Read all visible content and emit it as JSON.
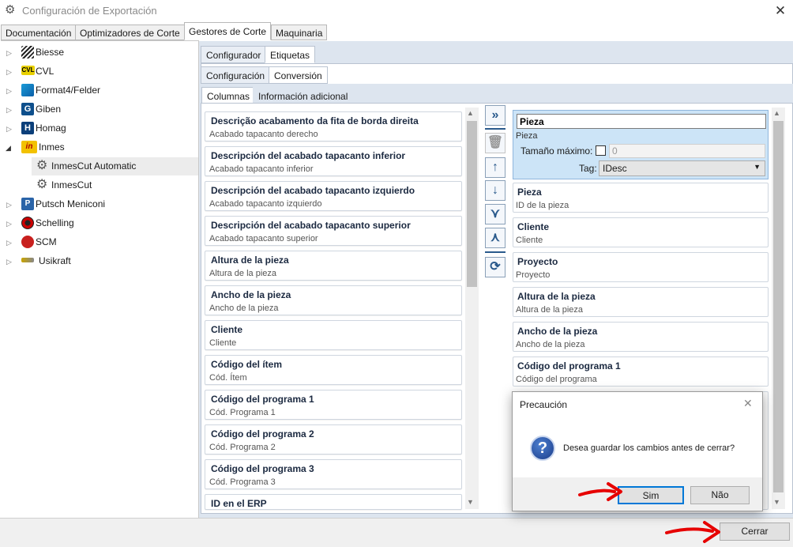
{
  "window": {
    "title": "Configuración de Exportación",
    "icon": "gear-icon",
    "close": "✕"
  },
  "main_tabs": [
    "Documentación",
    "Optimizadores de Corte",
    "Gestores de Corte",
    "Maquinaria"
  ],
  "tree": [
    {
      "label": "Biesse",
      "icon": "biesse-logo-icon"
    },
    {
      "label": "CVL",
      "icon": "cvl-logo-icon",
      "badge": "CVL"
    },
    {
      "label": "Format4/Felder",
      "icon": "format4-logo-icon"
    },
    {
      "label": "Giben",
      "icon": "giben-logo-icon",
      "badge": "G"
    },
    {
      "label": "Homag",
      "icon": "homag-logo-icon",
      "badge": "H"
    },
    {
      "label": "Inmes",
      "icon": "inmes-logo-icon",
      "badge": "in"
    },
    {
      "label": "InmesCut Automatic",
      "icon": "gear-icon"
    },
    {
      "label": "InmesCut",
      "icon": "gear-icon"
    },
    {
      "label": "Putsch Meniconi",
      "icon": "putsch-logo-icon",
      "badge": "P"
    },
    {
      "label": "Schelling",
      "icon": "schelling-logo-icon"
    },
    {
      "label": "SCM",
      "icon": "scm-logo-icon"
    },
    {
      "label": "Usikraft",
      "icon": "usikraft-logo-icon"
    }
  ],
  "sub_tabs_1": [
    "Configurador",
    "Etiquetas"
  ],
  "sub_tabs_2": [
    "Configuración",
    "Conversión"
  ],
  "sub_tabs_3": [
    "Columnas",
    "Información adicional"
  ],
  "available_columns": [
    {
      "title": "Descrição acabamento da fita de borda direita",
      "subtitle": "Acabado tapacanto derecho"
    },
    {
      "title": "Descripción del acabado tapacanto inferior",
      "subtitle": "Acabado tapacanto inferior"
    },
    {
      "title": "Descripción del acabado tapacanto izquierdo",
      "subtitle": "Acabado tapacanto izquierdo"
    },
    {
      "title": "Descripción del acabado tapacanto superior",
      "subtitle": "Acabado tapacanto superior"
    },
    {
      "title": "Altura de la pieza",
      "subtitle": "Altura de la pieza"
    },
    {
      "title": "Ancho de la pieza",
      "subtitle": "Ancho de la pieza"
    },
    {
      "title": "Cliente",
      "subtitle": "Cliente"
    },
    {
      "title": "Código del ítem",
      "subtitle": "Cód. Ítem"
    },
    {
      "title": "Código del programa 1",
      "subtitle": "Cód. Programa 1"
    },
    {
      "title": "Código del programa 2",
      "subtitle": "Cód. Programa 2"
    },
    {
      "title": "Código del programa 3",
      "subtitle": "Cód. Programa 3"
    },
    {
      "title": "ID en el ERP",
      "subtitle": ""
    }
  ],
  "toolbar_icons": [
    "move-all-right-icon",
    "delete-icon",
    "move-up-icon",
    "move-down-icon",
    "merge-icon",
    "split-icon",
    "refresh-icon"
  ],
  "selected_editor": {
    "name_value": "Pieza",
    "subtitle": "Pieza",
    "max_size_label": "Tamaño máximo:",
    "max_size_value": "0",
    "tag_label": "Tag:",
    "tag_value": "IDesc"
  },
  "selected_columns": [
    {
      "title": "Pieza",
      "subtitle": "ID de la pieza"
    },
    {
      "title": "Cliente",
      "subtitle": "Cliente"
    },
    {
      "title": "Proyecto",
      "subtitle": "Proyecto"
    },
    {
      "title": "Altura de la pieza",
      "subtitle": "Altura de la pieza"
    },
    {
      "title": "Ancho de la pieza",
      "subtitle": "Ancho de la pieza"
    },
    {
      "title": "Código del programa 1",
      "subtitle": "Código del programa"
    }
  ],
  "dialog": {
    "title": "Precaución",
    "message": "Desea guardar los cambios antes de cerrar?",
    "yes": "Sim",
    "no": "Não",
    "icon": "question-icon",
    "close": "✕"
  },
  "footer": {
    "close_button": "Cerrar"
  },
  "colors": {
    "accent_red": "#e60000",
    "selection": "#cce4f7",
    "panel": "#dde5ef"
  }
}
